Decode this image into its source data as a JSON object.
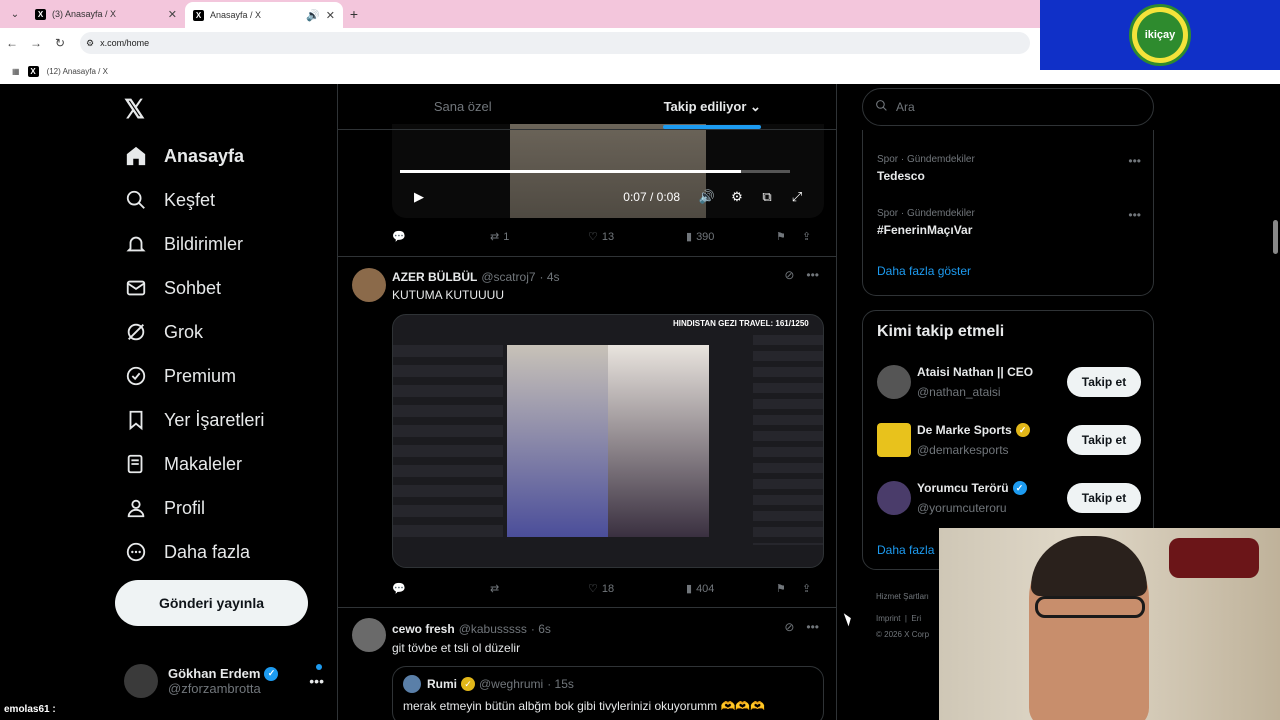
{
  "browser": {
    "tabs": [
      {
        "title": "(3) Anasayfa / X",
        "active": false
      },
      {
        "title": "Anasayfa / X",
        "active": true
      }
    ],
    "address": "x.com/home",
    "bookmark": "(12) Anasayfa / X"
  },
  "logo_text": "ikiçay",
  "sidebar": {
    "items": [
      {
        "label": "Anasayfa",
        "icon": "home-icon"
      },
      {
        "label": "Keşfet",
        "icon": "search-icon"
      },
      {
        "label": "Bildirimler",
        "icon": "bell-icon"
      },
      {
        "label": "Sohbet",
        "icon": "mail-icon"
      },
      {
        "label": "Grok",
        "icon": "grok-icon"
      },
      {
        "label": "Premium",
        "icon": "premium-icon"
      },
      {
        "label": "Yer İşaretleri",
        "icon": "bookmark-icon"
      },
      {
        "label": "Makaleler",
        "icon": "article-icon"
      },
      {
        "label": "Profil",
        "icon": "person-icon"
      },
      {
        "label": "Daha fazla",
        "icon": "more-icon"
      }
    ],
    "post_button": "Gönderi yayınla",
    "profile": {
      "name": "Gökhan Erdem",
      "handle": "@zforzambrotta"
    }
  },
  "chat_overlay": "emolas61 :",
  "feed": {
    "tabs": [
      "Sana özel",
      "Takip ediliyor"
    ],
    "video": {
      "time": "0:07 / 0:08",
      "progress": 0.875
    },
    "post0_actions": {
      "replies": "",
      "reposts": "1",
      "likes": "13",
      "views": "390"
    },
    "post1": {
      "name": "AZER BÜLBÜL",
      "handle": "@scatroj7",
      "time": "· 4s",
      "text": "KUTUMA KUTUUUU",
      "media_overlay": "HINDISTAN GEZI TRAVEL: 161/1250",
      "actions": {
        "replies": "",
        "reposts": "",
        "likes": "18",
        "views": "404"
      }
    },
    "post2": {
      "name": "cewo fresh",
      "handle": "@kabusssss",
      "time": "· 6s",
      "text": "git tövbe et tsli ol düzelir",
      "quote": {
        "name": "Rumi",
        "handle": "@weghrumi",
        "time": "· 15s",
        "text": "merak etmeyin bütün albğm bok gibi tivylerinizi okuyorumm 🫶🫶🫶"
      }
    }
  },
  "right": {
    "search_placeholder": "Ara",
    "trends": [
      {
        "category": "Spor · Gündemdekiler",
        "title": "Tedesco"
      },
      {
        "category": "Spor · Gündemdekiler",
        "title": "#FenerinMaçıVar"
      }
    ],
    "show_more": "Daha fazla göster",
    "who_to_follow": {
      "title": "Kimi takip etmeli",
      "users": [
        {
          "name": "Ataisi Nathan || CEO",
          "handle": "@nathan_ataisi",
          "verified": "",
          "button": "Takip et"
        },
        {
          "name": "De Marke Sports",
          "handle": "@demarkesports",
          "verified": "gold",
          "button": "Takip et"
        },
        {
          "name": "Yorumcu Terörü",
          "handle": "@yorumcuteroru",
          "verified": "blue",
          "button": "Takip et"
        }
      ],
      "show_more": "Daha fazla"
    },
    "footer": {
      "line1": "Hizmet Şartları",
      "line2": "Imprint",
      "line2b": "Eri",
      "line3": "© 2026 X Corp"
    }
  }
}
